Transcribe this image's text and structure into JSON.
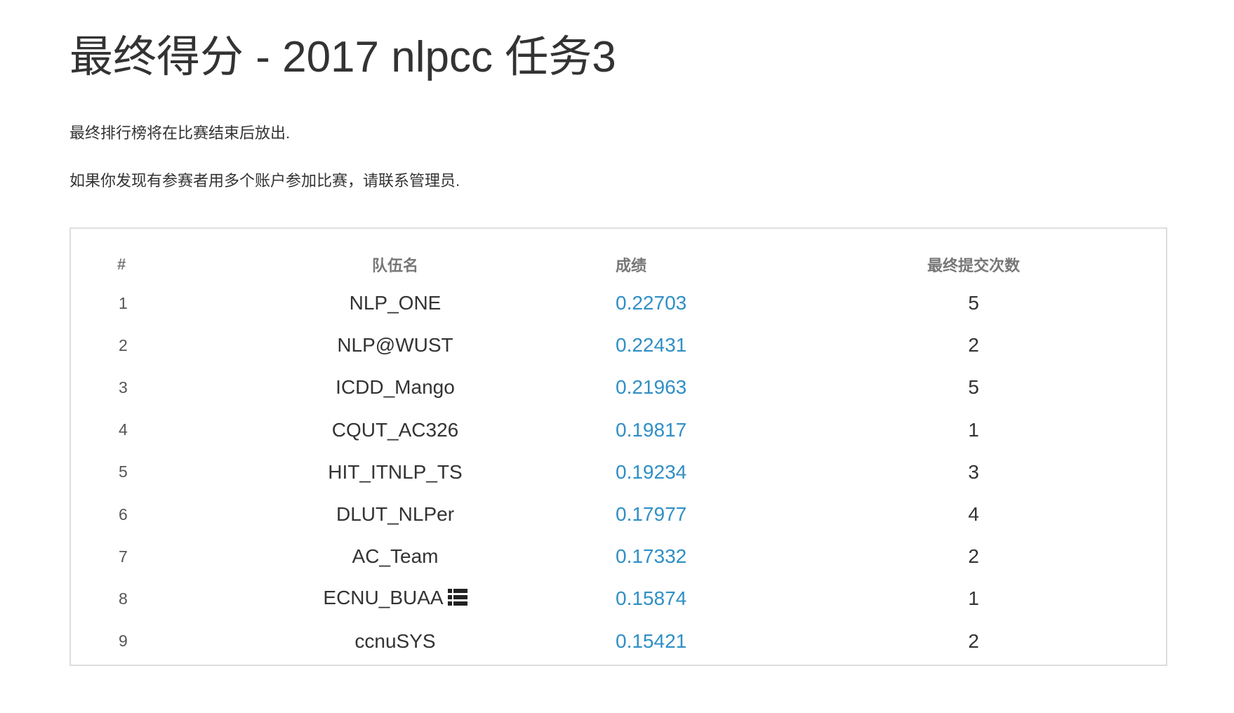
{
  "page": {
    "title": "最终得分 - 2017 nlpcc 任务3",
    "notes": [
      "最终排行榜将在比赛结束后放出.",
      "如果你发现有参赛者用多个账户参加比赛，请联系管理员."
    ]
  },
  "table": {
    "headers": {
      "rank": "#",
      "team": "队伍名",
      "score": "成绩",
      "submissions": "最终提交次数"
    },
    "rows": [
      {
        "rank": "1",
        "team": "NLP_ONE",
        "score": "0.22703",
        "submissions": "5",
        "icon": ""
      },
      {
        "rank": "2",
        "team": "NLP@WUST",
        "score": "0.22431",
        "submissions": "2",
        "icon": ""
      },
      {
        "rank": "3",
        "team": "ICDD_Mango",
        "score": "0.21963",
        "submissions": "5",
        "icon": ""
      },
      {
        "rank": "4",
        "team": "CQUT_AC326",
        "score": "0.19817",
        "submissions": "1",
        "icon": ""
      },
      {
        "rank": "5",
        "team": "HIT_ITNLP_TS",
        "score": "0.19234",
        "submissions": "3",
        "icon": ""
      },
      {
        "rank": "6",
        "team": "DLUT_NLPer",
        "score": "0.17977",
        "submissions": "4",
        "icon": ""
      },
      {
        "rank": "7",
        "team": "AC_Team",
        "score": "0.17332",
        "submissions": "2",
        "icon": ""
      },
      {
        "rank": "8",
        "team": "ECNU_BUAA",
        "score": "0.15874",
        "submissions": "1",
        "icon": "list-icon"
      },
      {
        "rank": "9",
        "team": "ccnuSYS",
        "score": "0.15421",
        "submissions": "2",
        "icon": ""
      }
    ]
  },
  "colors": {
    "text": "#333333",
    "header": "#777777",
    "link": "#2f8fc5",
    "border": "#dddddd"
  }
}
